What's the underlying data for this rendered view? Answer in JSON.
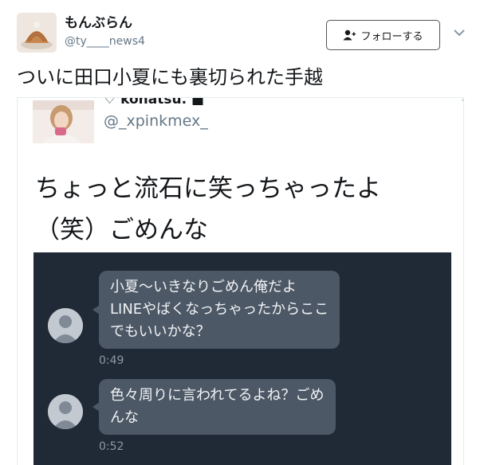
{
  "author": {
    "display_name": "もんぶらん",
    "handle": "@ty____news4",
    "avatar_icon": "avatar-image"
  },
  "follow_button": {
    "label": "フォローする",
    "icon": "add-user-icon"
  },
  "tweet": {
    "text": "ついに田口小夏にも裏切られた手越"
  },
  "embedded": {
    "name": "♡ konatsu. ■",
    "handle": "@_xpinkmex_",
    "text_lines": [
      "ちょっと流石に笑っちゃったよ",
      "（笑）ごめんな"
    ],
    "messages": [
      {
        "lines": [
          "小夏〜いきなりごめん俺だよ",
          "LINEやばくなっちゃったからここ",
          "でもいいかな？"
        ],
        "time": "0:49"
      },
      {
        "lines": [
          "色々周りに言われてるよね？ごめ",
          "んな"
        ],
        "time": "0:52"
      }
    ]
  },
  "colors": {
    "chat_bg": "#1f2a36",
    "bubble_bg": "#4c5866",
    "handle_gray": "#657786"
  }
}
